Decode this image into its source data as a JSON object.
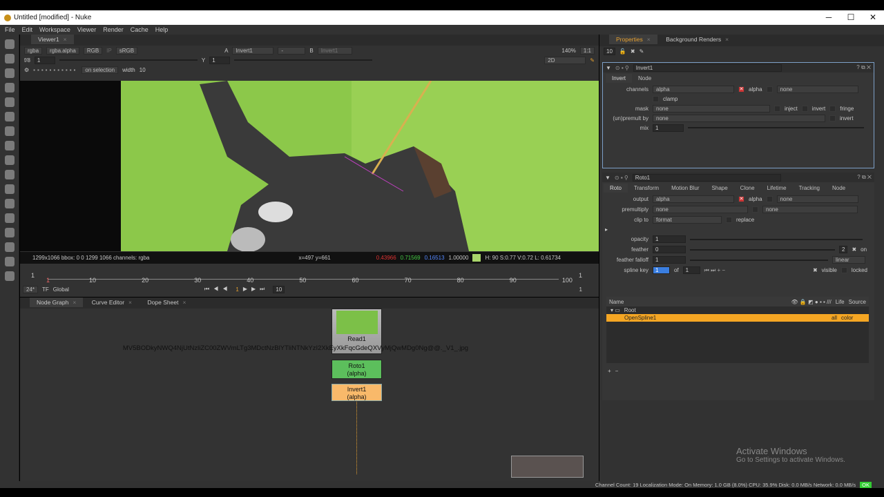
{
  "window": {
    "title": "Untitled [modified] - Nuke",
    "minimize": "─",
    "maximize": "☐",
    "close": "✕"
  },
  "menu": [
    "File",
    "Edit",
    "Workspace",
    "Viewer",
    "Render",
    "Cache",
    "Help"
  ],
  "viewer": {
    "tab": "Viewer1",
    "channels": "rgba",
    "channel_sel": "rgba.alpha",
    "display": "RGB",
    "ip": "IP",
    "lut": "sRGB",
    "input_a_label": "A",
    "input_a": "Invert1",
    "input_op": "-",
    "input_b_label": "B",
    "input_b": "Invert1",
    "zoom": "140%",
    "ratio": "1:1",
    "fstop": "f/8",
    "gain": "1",
    "gamma_label": "Y",
    "gamma": "1",
    "mode": "2D",
    "tool_mode": "on selection",
    "width_label": "width",
    "width": "10",
    "info_format": "1299x1066  bbox: 0 0 1299 1066 channels: rgba",
    "info_coords": "x=497 y=661",
    "info_r": "0.43966",
    "info_g": "0.71569",
    "info_b": "0.16513",
    "info_a": "1.00000",
    "info_hsv": "H: 90 S:0.77 V:0.72  L: 0.61734",
    "swatch_color": "#a8d46a"
  },
  "timeline": {
    "start": "1",
    "end": "1",
    "ticks": [
      "10",
      "20",
      "30",
      "40",
      "50",
      "60",
      "70",
      "80",
      "90",
      "100"
    ],
    "first": "1",
    "fps": "24*",
    "tf": "TF",
    "global": "Global",
    "frame": "1",
    "step": "10",
    "end_frame": "1"
  },
  "nodegraph": {
    "tabs": [
      "Node Graph",
      "Curve Editor",
      "Dope Sheet"
    ],
    "read": {
      "name": "Read1",
      "file": "MV5BODkyNWQ4NjUtNzliZC00ZWVmLTg3MDctNzBlYTliNTNkYzI2XkEyXkFqcGdeQXVyMjQwMDg0Ng@@._V1_.jpg"
    },
    "roto": {
      "name": "Roto1",
      "sub": "(alpha)"
    },
    "invert": {
      "name": "Invert1",
      "sub": "(alpha)"
    }
  },
  "properties": {
    "tabs": [
      "Properties",
      "Background Renders"
    ],
    "max_panels": "10",
    "invert": {
      "name": "Invert1",
      "tabs": [
        "Invert",
        "Node"
      ],
      "channels_label": "channels",
      "channels": "alpha",
      "alpha_label": "alpha",
      "none": "none",
      "clamp": "clamp",
      "mask_label": "mask",
      "mask": "none",
      "inject": "inject",
      "invert": "invert",
      "fringe": "fringe",
      "premult_label": "(un)premult by",
      "premult": "none",
      "premult_invert": "invert",
      "mix_label": "mix",
      "mix": "1"
    },
    "roto": {
      "name": "Roto1",
      "tabs": [
        "Roto",
        "Transform",
        "Motion Blur",
        "Shape",
        "Clone",
        "Lifetime",
        "Tracking",
        "Node"
      ],
      "output_label": "output",
      "output": "alpha",
      "alpha_label": "alpha",
      "output_none": "none",
      "premult_label": "premultiply",
      "premult": "none",
      "premult_none": "none",
      "clip_label": "clip to",
      "clip": "format",
      "replace": "replace",
      "opacity_label": "opacity",
      "opacity": "1",
      "feather_label": "feather",
      "feather": "0",
      "feather_num": "2",
      "on": "on",
      "falloff_label": "feather falloff",
      "falloff": "1",
      "falloff_type": "linear",
      "spline_label": "spline key",
      "spline": "1",
      "of": "of",
      "of_val": "1",
      "visible": "visible",
      "locked": "locked",
      "cols": {
        "name": "Name",
        "life": "Life",
        "source": "Source"
      },
      "items": [
        {
          "name": "Root"
        },
        {
          "name": "OpenSpline1",
          "life": "all",
          "source": "color"
        }
      ],
      "add": "+",
      "remove": "−"
    }
  },
  "watermark": {
    "title": "Activate Windows",
    "sub": "Go to Settings to activate Windows."
  },
  "status": {
    "text": "Channel Count: 19  Localization Mode: On  Memory: 1.0 GB (8.0%)  CPU: 35.9%  Disk: 0.0 MB/s  Network: 0.0 MB/s",
    "ok": "OK"
  }
}
